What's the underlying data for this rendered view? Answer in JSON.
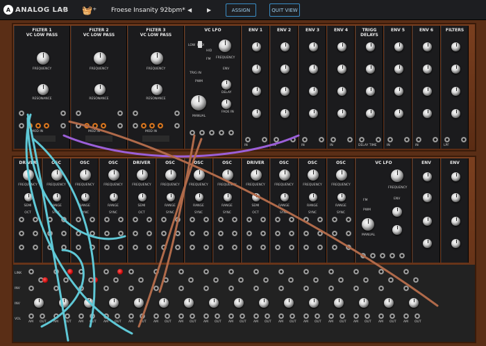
{
  "topbar": {
    "logo": "A",
    "brand": "ANALOG LAB",
    "brand_caret": "▼",
    "store_icon": "🧺⁺",
    "preset": "Froese Insanity 92bpm*",
    "prev": "◀",
    "next": "▶",
    "assign": "ASSIGN",
    "quit": "QUIT VIEW"
  },
  "cab1": [
    {
      "title": "FILTER 1\nVC LOW PASS",
      "labels": [
        "FREQUENCY",
        "RESONANCE",
        "IN",
        "MOD IN",
        "OUT"
      ]
    },
    {
      "title": "FILTER 2\nVC LOW PASS",
      "labels": [
        "FREQUENCY",
        "RESONANCE",
        "IN",
        "MOD IN",
        "OUT"
      ]
    },
    {
      "title": "FILTER 3\nVC LOW PASS",
      "labels": [
        "FREQUENCY",
        "RESONANCE",
        "IN",
        "MOD IN",
        "OUT"
      ]
    },
    {
      "title": "VC LFO",
      "labels": [
        "FREQUENCY",
        "FM",
        "TRIG IN",
        "PWM",
        "MANUAL",
        "ENV",
        "DELAY",
        "FADE IN"
      ]
    },
    {
      "title": "ENV 1",
      "labels": [
        "IN",
        "OUT"
      ]
    },
    {
      "title": "ENV 2",
      "labels": [
        "IN",
        "OUT"
      ]
    },
    {
      "title": "ENV 3",
      "labels": [
        "IN",
        "OUT"
      ]
    },
    {
      "title": "ENV 4",
      "labels": [
        "IN",
        "OUT"
      ]
    },
    {
      "title": "TRIGG\nDELAYS",
      "labels": [
        "DELAY TIME",
        "TRIG IN",
        "COUPLING",
        "DELAY TIME",
        "TRIG IN"
      ]
    },
    {
      "title": "ENV 5",
      "labels": [
        "IN",
        "OUT"
      ]
    },
    {
      "title": "ENV 6",
      "labels": [
        "IN",
        "OUT"
      ]
    },
    {
      "title": "FILTERS",
      "labels": [
        "LPF",
        "HPF",
        "NOISE",
        "WHITE",
        "PINK"
      ]
    }
  ],
  "lfo_switch": [
    "LOW",
    "MIDI",
    "HID"
  ],
  "cab2": [
    {
      "title": "DRIVER",
      "labels": [
        "FREQUENCY",
        "SEMI",
        "OCT",
        "PULSE WIDTH",
        "K1",
        "No"
      ]
    },
    {
      "title": "OSC",
      "labels": [
        "FREQUENCY",
        "RANGE",
        "SYNC"
      ]
    },
    {
      "title": "OSC",
      "labels": [
        "FREQUENCY",
        "RANGE",
        "SYNC"
      ]
    },
    {
      "title": "OSC",
      "labels": [
        "FREQUENCY",
        "RANGE",
        "SYNC"
      ]
    },
    {
      "title": "DRIVER",
      "labels": [
        "FREQUENCY",
        "SEMI",
        "OCT",
        "PULSE WIDTH",
        "K1",
        "No"
      ]
    },
    {
      "title": "OSC",
      "labels": [
        "FREQUENCY",
        "RANGE",
        "SYNC",
        "FM"
      ]
    },
    {
      "title": "OSC",
      "labels": [
        "FREQUENCY",
        "RANGE",
        "SYNC",
        "FM"
      ]
    },
    {
      "title": "OSC",
      "labels": [
        "FREQUENCY",
        "RANGE",
        "SYNC",
        "FM"
      ]
    },
    {
      "title": "DRIVER",
      "labels": [
        "FREQUENCY",
        "SEMI",
        "OCT",
        "PULSE WIDTH",
        "K1",
        "No"
      ]
    },
    {
      "title": "OSC",
      "labels": [
        "FREQUENCY",
        "RANGE",
        "SYNC",
        "FM"
      ]
    },
    {
      "title": "OSC",
      "labels": [
        "FREQUENCY",
        "RANGE",
        "SYNC",
        "FM"
      ]
    },
    {
      "title": "OSC",
      "labels": [
        "FREQUENCY",
        "RANGE",
        "SYNC",
        "FM"
      ]
    },
    {
      "title": "VC LFO",
      "labels": [
        "FREQUENCY",
        "FM",
        "TRIG IN",
        "PWM",
        "MANUAL",
        "ENV",
        "DELAY",
        "FADE IN"
      ]
    },
    {
      "title": "ENV",
      "labels": [
        "SLOPE",
        "IN",
        "OUT",
        "AM",
        "VCA IN",
        "SOFT CLIP"
      ]
    },
    {
      "title": "ENV",
      "labels": [
        "SLOPE",
        "IN",
        "OUT",
        "AM",
        "VCA IN",
        "SOFT CLIP"
      ]
    }
  ],
  "ribbon": {
    "left": [
      "LINK",
      "INV",
      "INV",
      "VOL"
    ],
    "bottom": [
      "AM",
      "OUT"
    ]
  },
  "colors": {
    "panel": "#1b1b1d",
    "wood": "#6a341a",
    "cable_cyan": "#5fc8d6",
    "cable_purple": "#9b5fd8",
    "cable_brown": "#b06a4a",
    "accent": "#3a8ec7"
  }
}
